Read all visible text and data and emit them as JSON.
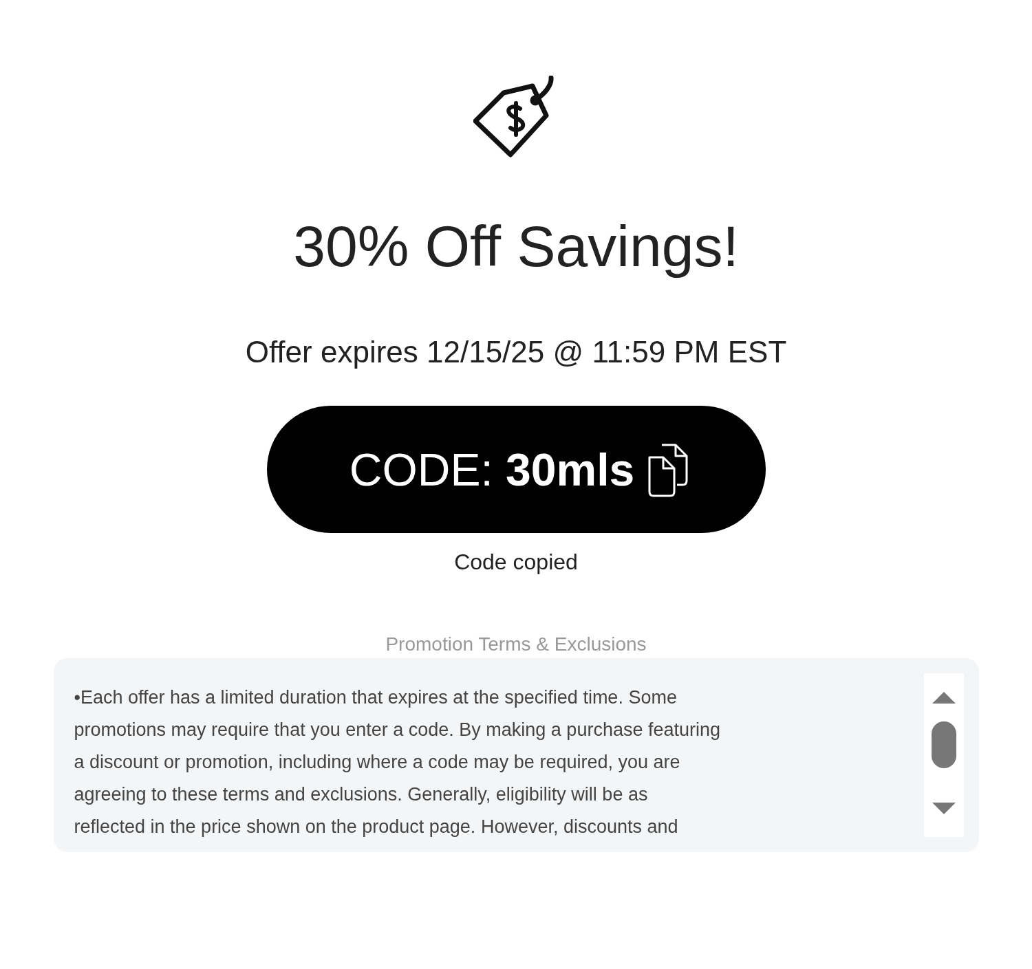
{
  "offer": {
    "title": "30% Off Savings!",
    "expiry": "Offer expires 12/15/25 @ 11:59 PM EST"
  },
  "code_button": {
    "label": "CODE: **30mls**"
  },
  "copy_status": "Code copied",
  "terms": {
    "heading": "Promotion Terms & Exclusions",
    "text": "•Each offer has a limited duration that expires at the specified time. Some\npromotions may require that you enter a code. By making a purchase featuring\na discount or promotion, including where a code may be required, you are\nagreeing to these terms and exclusions. Generally, eligibility will be as\nreflected in the price shown on the product page. However, discounts and"
  }
}
